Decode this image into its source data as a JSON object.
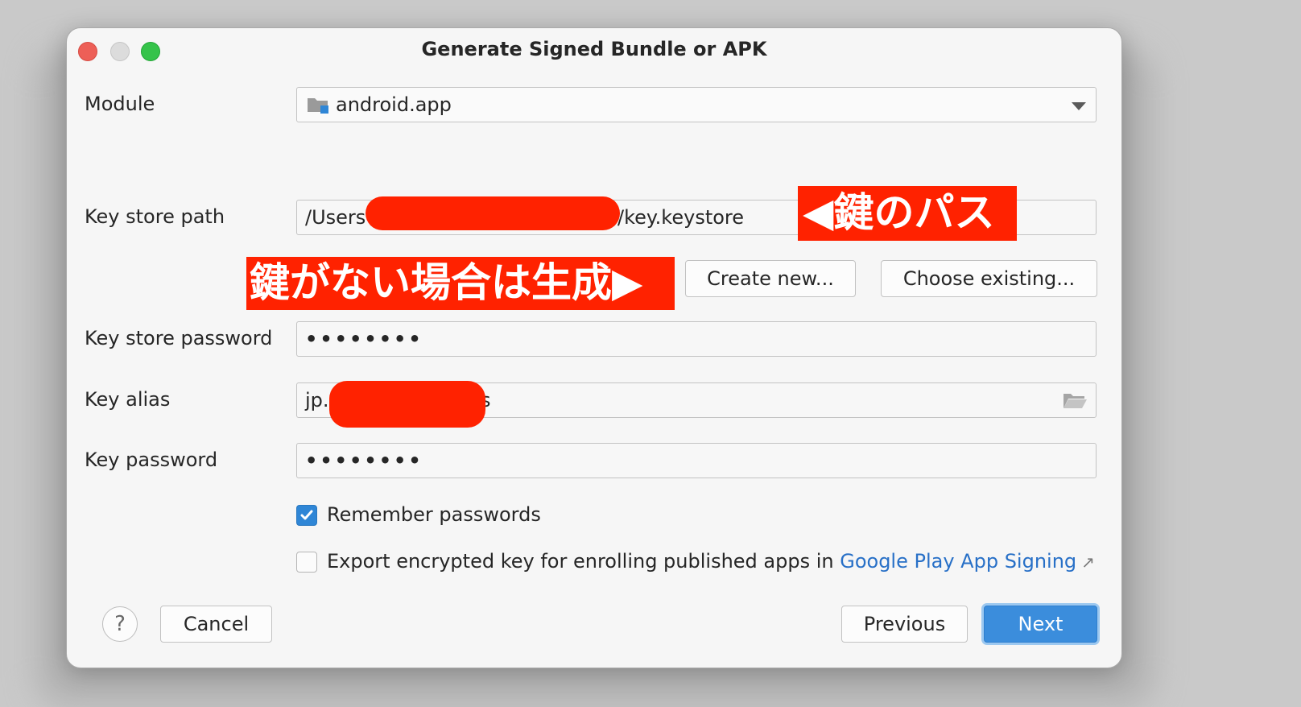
{
  "window": {
    "title": "Generate Signed Bundle or APK"
  },
  "form": {
    "module_label": "Module",
    "module_value": "android.app",
    "keystore_path_label": "Key store path",
    "keystore_path_prefix": "/Users",
    "keystore_path_suffix": "/key.keystore",
    "create_new_label": "Create new...",
    "choose_existing_label": "Choose existing...",
    "keystore_password_label": "Key store password",
    "keystore_password_value": "••••••••",
    "key_alias_label": "Key alias",
    "key_alias_prefix": "jp.",
    "key_alias_suffix": "s",
    "key_password_label": "Key password",
    "key_password_value": "••••••••",
    "remember_passwords_label": "Remember passwords",
    "remember_passwords_checked": true,
    "export_key_label": "Export encrypted key for enrolling published apps in ",
    "export_key_link": "Google Play App Signing",
    "export_key_checked": false
  },
  "annotations": {
    "path_note": "◀鍵のパス",
    "create_note": "鍵がない場合は生成▶"
  },
  "footer": {
    "help_label": "?",
    "cancel_label": "Cancel",
    "previous_label": "Previous",
    "next_label": "Next"
  },
  "colors": {
    "annotation": "#ff2200",
    "primary_button": "#3b8ddc",
    "checkbox_checked": "#2f86d6",
    "link": "#2870c7"
  },
  "icons": {
    "module": "module-folder-icon",
    "dropdown": "chevron-down-icon",
    "alias_browse": "folder-open-icon",
    "external_link": "arrow-up-right-icon"
  }
}
